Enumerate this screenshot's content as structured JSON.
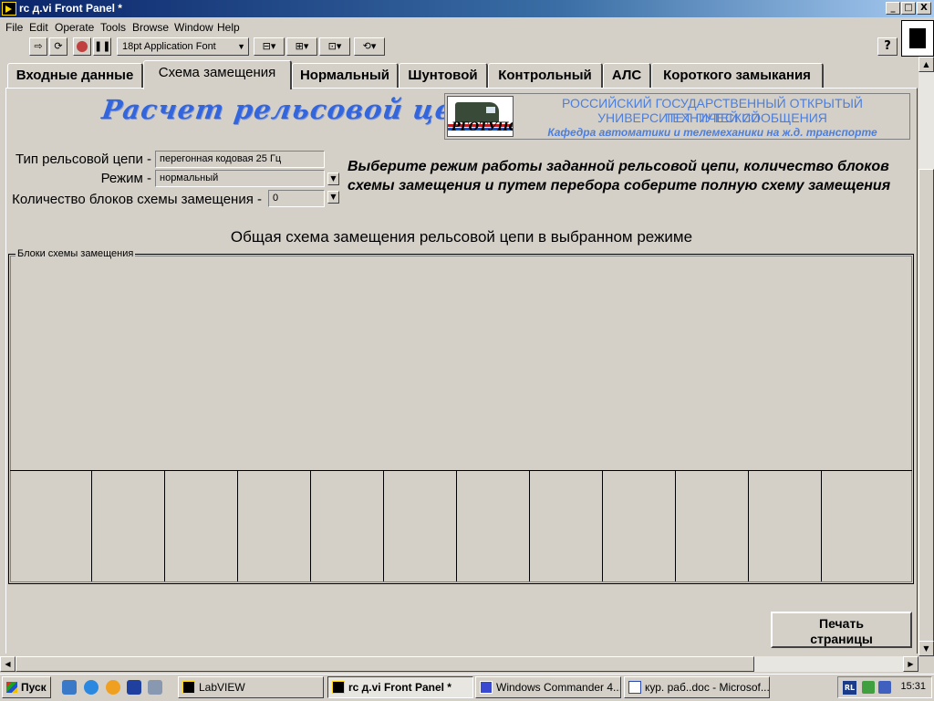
{
  "window": {
    "title": "rc д.vi Front Panel *",
    "controls": {
      "minimize": "_",
      "maximize": "□",
      "close": "X"
    }
  },
  "menu": [
    "File",
    "Edit",
    "Operate",
    "Tools",
    "Browse",
    "Window",
    "Help"
  ],
  "toolbar": {
    "font_label": "18pt Application Font",
    "icons": [
      "run-arrow-icon",
      "run-continuous-icon",
      "abort-icon",
      "pause-icon",
      "align-icon",
      "distribute-icon",
      "resize-icon",
      "reorder-icon"
    ],
    "help_label": "?"
  },
  "tabs": [
    {
      "label": "Входные данные",
      "active": false
    },
    {
      "label": "Схема замещения",
      "active": true
    },
    {
      "label": "Нормальный",
      "active": false
    },
    {
      "label": "Шунтовой",
      "active": false
    },
    {
      "label": "Контрольный",
      "active": false
    },
    {
      "label": "АЛС",
      "active": false
    },
    {
      "label": "Короткого замыкания",
      "active": false
    }
  ],
  "panel": {
    "heading": "Расчет рельсовой цепи",
    "university": {
      "line1": "РОССИЙСКИЙ ГОСУДАРСТВЕННЫЙ ОТКРЫТЫЙ ТЕХНИЧЕСКИЙ",
      "line2": "УНИВЕРСИТЕТ ПУТЕЙ СООБЩЕНИЯ",
      "department": "Кафедра автоматики и телемеханики на ж.д. транспорте",
      "logo_text": "РГОТУПС"
    },
    "controls": {
      "circuit_type": {
        "label": "Тип рельсовой цепи -",
        "value": "перегонная кодовая 25 Гц"
      },
      "mode": {
        "label": "Режим -",
        "value": "нормальный"
      },
      "block_count": {
        "label": "Количество блоков схемы замещения -",
        "value": "0"
      }
    },
    "instruction": "Выберите режим работы заданной рельсовой цепи, количество блоков схемы замещения и путем перебора соберите полную схему замещения",
    "scheme_caption": "Общая схема замещения рельсовой цепи в выбранном режиме",
    "blocks_group_label": "Блоки схемы замещения",
    "print_button": {
      "line1": "Печать",
      "line2": "страницы"
    }
  },
  "taskbar": {
    "start_label": "Пуск",
    "tasks": [
      {
        "label": "LabVIEW",
        "active": false
      },
      {
        "label": "rc д.vi Front Panel *",
        "active": true
      },
      {
        "label": "Windows Commander 4....",
        "active": false
      },
      {
        "label": "кур. раб..doc - Microsof...",
        "active": false
      }
    ],
    "language": "RL",
    "clock": "15:31"
  },
  "colors": {
    "title_bar": "#0a246a",
    "panel_bg": "#d4d0c8",
    "heading": "#3366dd",
    "university_text": "#4a7ee0"
  }
}
